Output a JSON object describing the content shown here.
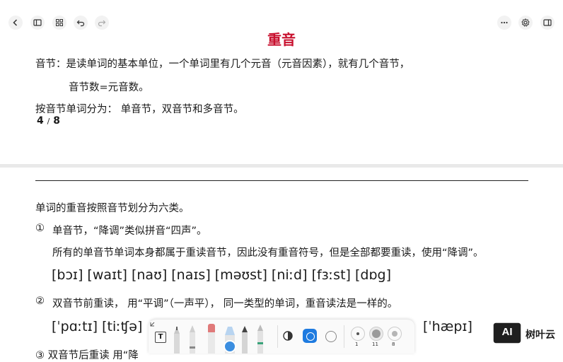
{
  "page1": {
    "title": "重音",
    "line1": "音节：是读单词的基本单位，一个单词里有几个元音（元音因素），就有几个音节，",
    "line2": "音节数=元音数。",
    "line3": "按音节单词分为：  单音节，双音节和多音节。",
    "page_num": "4",
    "page_total": "8"
  },
  "page2": {
    "intro": "单词的重音按照音节划分为六类。",
    "item1_num": "①",
    "item1_title": "单音节，“降调”类似拼音“四声”。",
    "item1_desc": "所有的单音节单词本身都属于重读音节，因此没有重音符号，但是全部都要重读，使用“降调”。",
    "item1_phonetics": "[bɔɪ] [waɪt] [naʊ] [naɪs] [məʊst] [niːd] [fɜːst] [dɒg]",
    "item2_num": "②",
    "item2_title": "双音节前重读， 用“平调”（一声平）， 同一类型的单词，重音读法是一样的。",
    "item2_phon_left": "[ˈpɑːtɪ] [tiːʧə]",
    "item2_phon_right": "[ˈhæpɪ]",
    "item3_partial": "③  双音节后重读 用“降"
  },
  "toolbar": {
    "sizes": [
      "1",
      "11",
      "8"
    ],
    "text_tool": "T"
  },
  "watermark": {
    "logo_text": "AI",
    "brand": "树叶云"
  },
  "colors": {
    "title": "#c8102e",
    "accent": "#1e7be0"
  }
}
